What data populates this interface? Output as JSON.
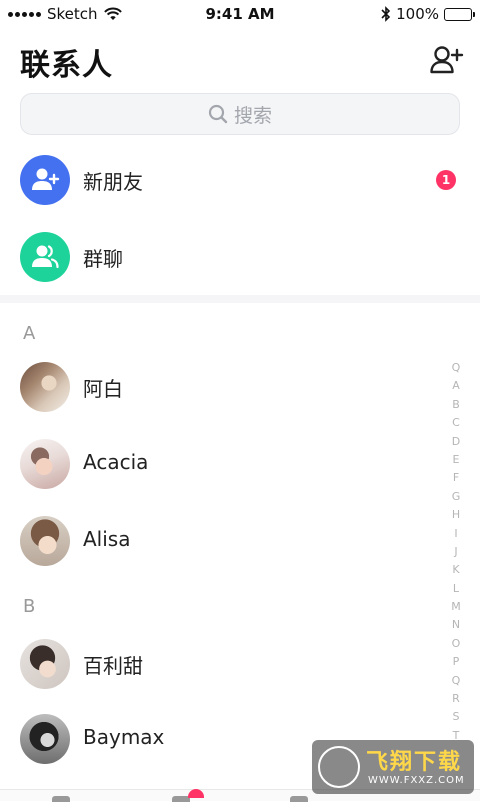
{
  "status_bar": {
    "carrier": "Sketch",
    "time": "9:41 AM",
    "battery": "100%"
  },
  "header": {
    "title": "联系人"
  },
  "search": {
    "placeholder": "搜索"
  },
  "fixed_rows": [
    {
      "label": "新朋友",
      "badge": "1",
      "color": "#4471f0"
    },
    {
      "label": "群聊",
      "color": "#1ed39a"
    }
  ],
  "sections": [
    {
      "letter": "A",
      "contacts": [
        "阿白",
        "Acacia",
        "Alisa"
      ]
    },
    {
      "letter": "B",
      "contacts": [
        "百利甜",
        "Baymax"
      ]
    }
  ],
  "alpha_index": [
    "Q",
    "A",
    "B",
    "C",
    "D",
    "E",
    "F",
    "G",
    "H",
    "I",
    "J",
    "K",
    "L",
    "M",
    "N",
    "O",
    "P",
    "Q",
    "R",
    "S",
    "T"
  ],
  "watermark": {
    "title": "飞翔下载",
    "url": "WWW.FXXZ.COM"
  },
  "colors": {
    "accent_blue": "#4471f0",
    "accent_green": "#1ed39a",
    "badge": "#ff3366"
  }
}
